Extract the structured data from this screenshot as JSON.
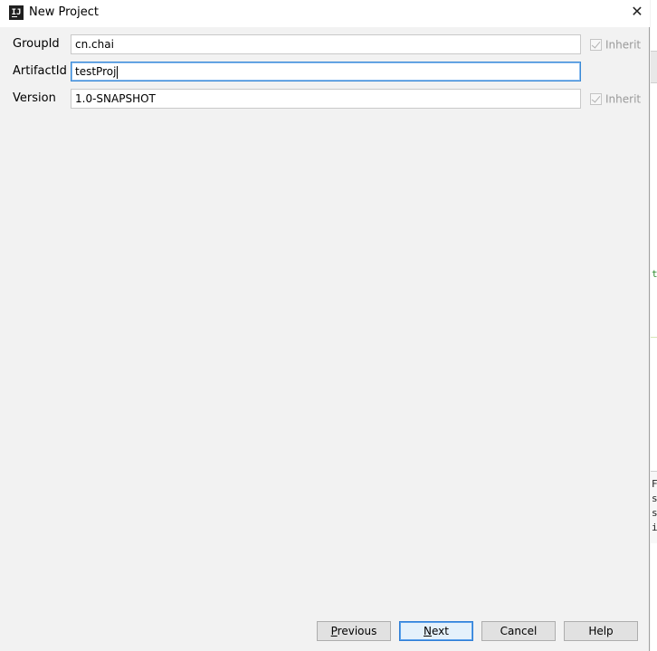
{
  "window": {
    "title": "New Project",
    "app_icon": "intellij-icon",
    "close_glyph": "✕"
  },
  "form": {
    "group_id": {
      "label": "GroupId",
      "value": "cn.chai",
      "inherit_label": "Inherit",
      "inherit_checked": true
    },
    "artifact_id": {
      "label": "ArtifactId",
      "value": "testProj"
    },
    "version": {
      "label": "Version",
      "value": "1.0-SNAPSHOT",
      "inherit_label": "Inherit",
      "inherit_checked": true
    }
  },
  "buttons": {
    "previous": {
      "first": "P",
      "rest": "revious"
    },
    "next": {
      "first": "N",
      "rest": "ext"
    },
    "cancel": "Cancel",
    "help": "Help"
  },
  "background_app": {
    "glyphs": [
      "t",
      "F",
      "s",
      "s",
      "i"
    ]
  },
  "colors": {
    "focus_border": "#3b8ad6",
    "default_button": "#2f7fd7",
    "background": "#f2f2f2"
  }
}
